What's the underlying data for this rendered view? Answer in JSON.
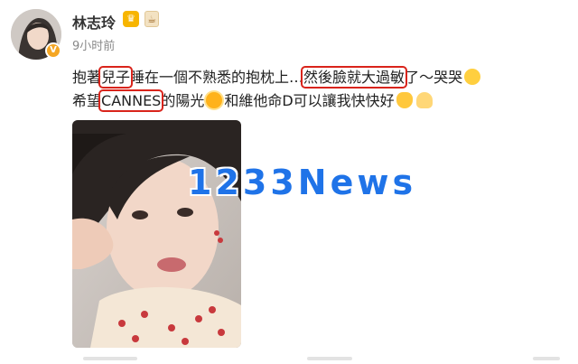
{
  "user": {
    "name": "林志玲",
    "time": "9小时前",
    "verified_color": "#f5a623"
  },
  "post": {
    "line1": [
      {
        "text": "抱著",
        "hl": false
      },
      {
        "text": "兒子",
        "hl": true
      },
      {
        "text": "睡在一個不熟悉的抱枕上…",
        "hl": false
      },
      {
        "text": "然後臉就大過敏",
        "hl": true
      },
      {
        "text": "了～哭哭",
        "hl": false
      }
    ],
    "line2": [
      {
        "text": "希望",
        "hl": false
      },
      {
        "text": "CANNES",
        "hl": true
      },
      {
        "text": "的陽光",
        "hl": false
      },
      {
        "text": "和維他命D可以讓我快快好",
        "hl": false
      }
    ],
    "highlight_color": "#d9241b"
  },
  "watermark": "1233News",
  "icons": [
    "vip-crown-icon",
    "milk-tea-icon",
    "crying-emoji-icon",
    "sun-emoji-icon",
    "hands-emoji-icon",
    "pray-emoji-icon"
  ]
}
